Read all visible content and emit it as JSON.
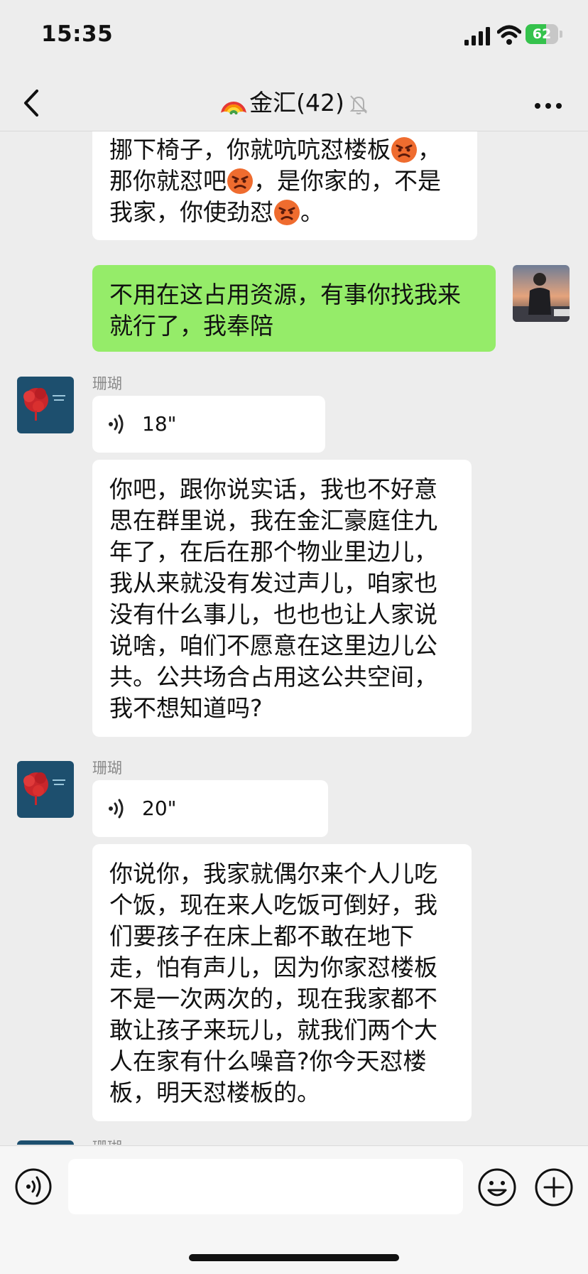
{
  "status": {
    "time": "15:35",
    "battery": "62",
    "battery_level": 0.62
  },
  "header": {
    "title": "金汇(42)"
  },
  "messages": {
    "m1": {
      "lines": [
        "挪下椅子，你就吭吭怼楼板",
        "，",
        "那你就怼吧",
        "，是你家的，不是",
        "我家，你使劲怼",
        "。"
      ]
    },
    "m2": {
      "text": "不用在这占用资源，有事你找我来就行了，我奉陪"
    },
    "m3": {
      "sender": "珊瑚",
      "voice": "18\""
    },
    "m4": {
      "text": "你吧，跟你说实话，我也不好意思在群里说，我在金汇豪庭住九年了，在后在那个物业里边儿，我从来就没有发过声儿，咱家也没有什么事儿，也也也让人家说说啥，咱们不愿意在这里边儿公共。公共场合占用这公共空间，我不想知道吗?"
    },
    "m5": {
      "sender": "珊瑚",
      "voice": "20\""
    },
    "m6": {
      "text": "你说你，我家就偶尔来个人儿吃个饭，现在来人吃饭可倒好，我们要孩子在床上都不敢在地下走，怕有声儿，因为你家怼楼板不是一次两次的，现在我家都不敢让孩子来玩儿，就我们两个大人在家有什么噪音?你今天怼楼板，明天怼楼板的。"
    },
    "m7": {
      "sender": "珊瑚"
    }
  },
  "colors": {
    "bubble_self": "#95ec69",
    "bubble_other": "#ffffff",
    "background": "#ededed"
  },
  "icons": [
    "back-icon",
    "rainbow-icon",
    "mute-bell-icon",
    "more-icon",
    "voice-wave-icon",
    "angry-emoji-icon",
    "voice-toggle-icon",
    "emoji-button-icon",
    "plus-icon"
  ]
}
